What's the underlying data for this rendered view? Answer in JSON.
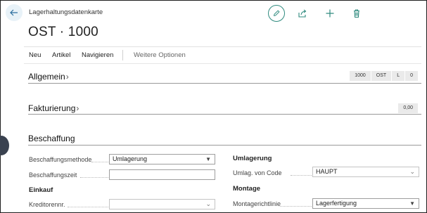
{
  "header": {
    "caption": "Lagerhaltungsdatenkarte",
    "title": "OST · 1000"
  },
  "actions": {
    "edit_icon": "pencil-icon",
    "share_icon": "share-icon",
    "add_icon": "plus-icon",
    "delete_icon": "trash-icon",
    "accent": "#2e8a7e"
  },
  "menu": {
    "new": "Neu",
    "item": "Artikel",
    "navigate": "Navigieren",
    "more": "Weitere Optionen"
  },
  "sections": {
    "general": {
      "title": "Allgemein",
      "badges": [
        "1000",
        "OST",
        "L",
        "0"
      ]
    },
    "invoicing": {
      "title": "Fakturierung",
      "badges": [
        "0,00"
      ]
    },
    "replenishment": {
      "title": "Beschaffung"
    }
  },
  "form": {
    "replenishment_method": {
      "label": "Beschaffungsmethode",
      "value": "Umlagerung"
    },
    "lead_time": {
      "label": "Beschaffungszeit",
      "value": ""
    },
    "purchase_group": "Einkauf",
    "vendor_no": {
      "label": "Kreditorennr.",
      "value": ""
    },
    "transfer_group": "Umlagerung",
    "transfer_from": {
      "label": "Umlag. von Code",
      "value": "HAUPT"
    },
    "assembly_group": "Montage",
    "assembly_policy": {
      "label": "Montagerichtlinie",
      "value": "Lagerfertigung"
    }
  }
}
